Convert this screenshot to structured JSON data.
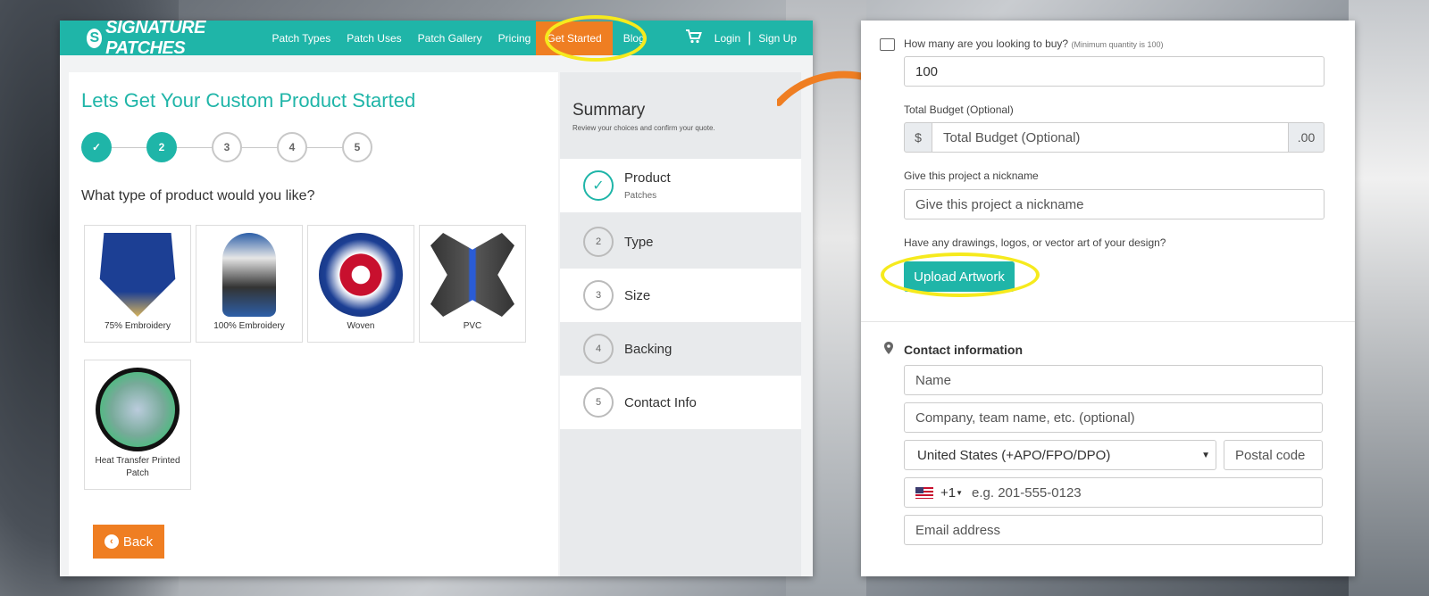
{
  "nav": {
    "logo": "SIGNATURE PATCHES",
    "links": [
      "Patch Types",
      "Patch Uses",
      "Patch Gallery",
      "Pricing"
    ],
    "active": "Get Started",
    "after_active": "Blog",
    "login": "Login",
    "separator": "|",
    "signup": "Sign Up"
  },
  "main": {
    "title": "Lets Get Your Custom Product Started",
    "steps": [
      "✓",
      "2",
      "3",
      "4",
      "5"
    ],
    "question": "What type of product would you like?",
    "products": [
      "75% Embroidery",
      "100% Embroidery",
      "Woven",
      "PVC",
      "Heat Transfer Printed Patch"
    ],
    "back_label": "Back"
  },
  "summary": {
    "title": "Summary",
    "subtitle": "Review your choices and confirm your quote.",
    "items": [
      {
        "num": "✓",
        "label": "Product",
        "value": "Patches"
      },
      {
        "num": "2",
        "label": "Type",
        "value": ""
      },
      {
        "num": "3",
        "label": "Size",
        "value": ""
      },
      {
        "num": "4",
        "label": "Backing",
        "value": ""
      },
      {
        "num": "5",
        "label": "Contact Info",
        "value": ""
      }
    ]
  },
  "form": {
    "qty_label": "How many are you looking to buy?",
    "qty_hint": "(Minimum quantity is 100)",
    "qty_value": "100",
    "budget_label": "Total Budget (Optional)",
    "budget_prefix": "$",
    "budget_placeholder": "Total Budget (Optional)",
    "budget_suffix": ".00",
    "nickname_label": "Give this project a nickname",
    "nickname_placeholder": "Give this project a nickname",
    "artwork_label": "Have any drawings, logos, or vector art of your design?",
    "upload_label": "Upload Artwork",
    "contact_title": "Contact information",
    "name_placeholder": "Name",
    "company_placeholder": "Company, team name, etc. (optional)",
    "country": "United States (+APO/FPO/DPO)",
    "postal_placeholder": "Postal code",
    "phone_code": "+1",
    "phone_placeholder": "e.g. 201-555-0123",
    "email_placeholder": "Email address"
  },
  "colors": {
    "teal": "#1fb5a8",
    "orange": "#ef7e22",
    "highlight": "#f6ea1d"
  }
}
